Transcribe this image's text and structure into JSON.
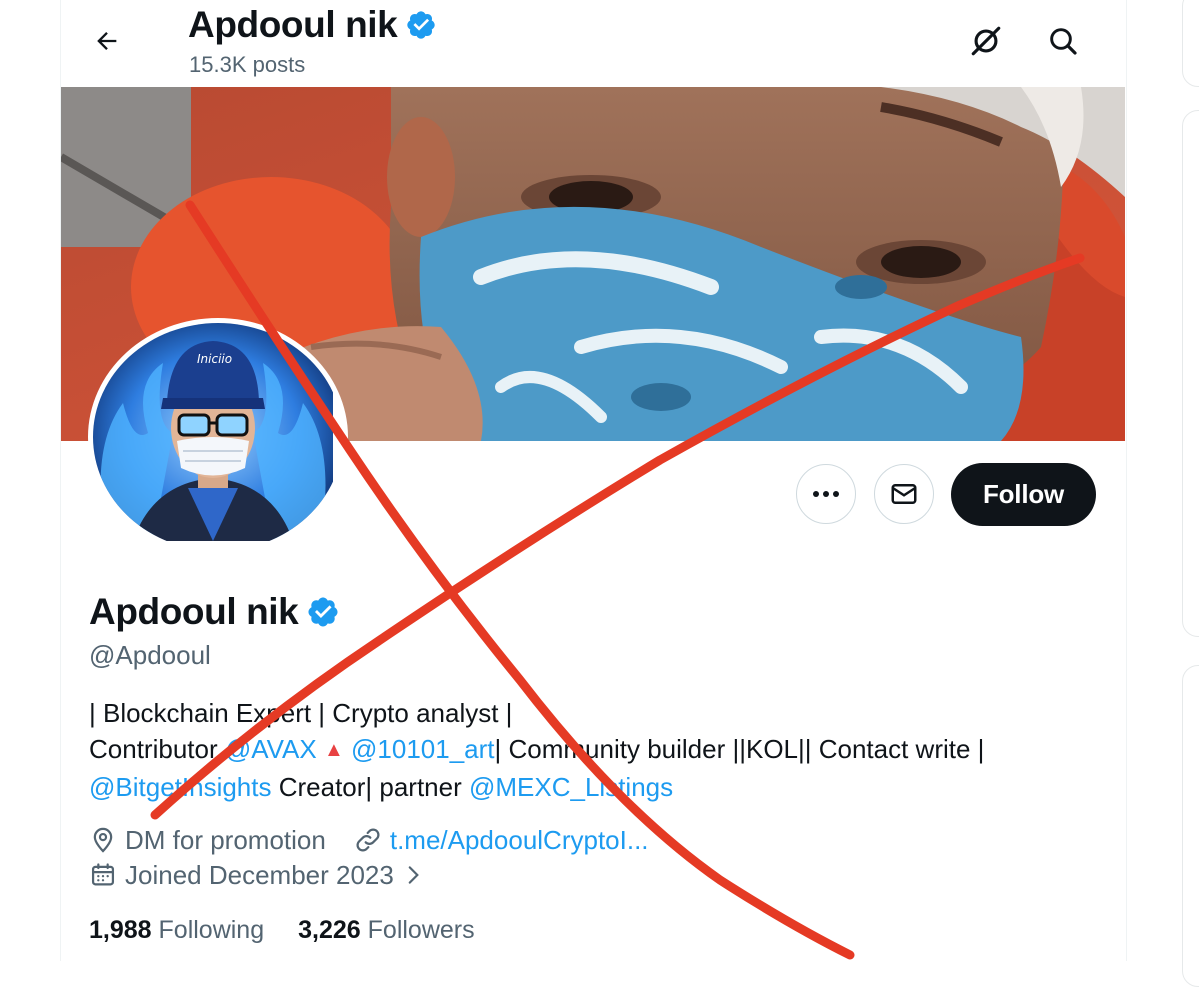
{
  "header": {
    "title": "Apdooul nik",
    "posts": "15.3K posts",
    "icons": [
      "back-arrow-icon",
      "verified-badge-icon",
      "grok-icon",
      "search-icon"
    ]
  },
  "profile": {
    "name": "Apdooul nik",
    "handle": "@Apdooul",
    "bio": {
      "line1": "| Blockchain Expert | Crypto analyst |",
      "line2_a": "Contributor ",
      "line2_m1": "@AVAX",
      "line2_sep": " ",
      "line2_m2": "@10101_art",
      "line2_b": "| Community builder ||KOL|| Contact write |",
      "line3_m1": "@BitgetInsights",
      "line3_b": " Creator| partner ",
      "line3_m2": "@MEXC_Listings"
    },
    "location": "DM for promotion",
    "website": "t.me/ApdooulCryptoI...",
    "joined": "Joined December 2023",
    "following_count": "1,988",
    "following_label": "Following",
    "followers_count": "3,226",
    "followers_label": "Followers"
  },
  "actions": {
    "more_label": "···",
    "follow_label": "Follow"
  },
  "colors": {
    "accent": "#1d9bf0",
    "text": "#0f1419",
    "secondary": "#536471",
    "follow_bg": "#0f1419",
    "avax_red": "#e84142",
    "overlay_cross": "#e53a24"
  }
}
